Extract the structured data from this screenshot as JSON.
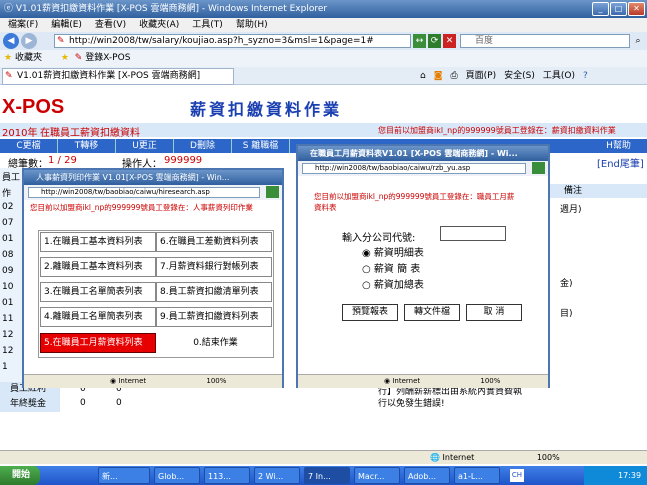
{
  "window": {
    "title": "V1.01薪資扣繳資料作業 [X-POS 雲端商務網] - Windows Internet Explorer",
    "address": "http://win2008/tw/salary/koujiao.asp?h_syzno=3&msl=1&page=1#",
    "search_placeholder": "百度",
    "menu": [
      "檔案(F)",
      "編輯(E)",
      "查看(V)",
      "收藏夾(A)",
      "工具(T)",
      "幫助(H)"
    ],
    "favorites_label": "收藏夾",
    "fav_link": "登錄X-POS",
    "tab_label": "V1.01薪資扣繳資料作業 [X-POS 雲端商務網]",
    "cmd": {
      "page": "頁面(P)",
      "safety": "安全(S)",
      "tools": "工具(O)"
    }
  },
  "page": {
    "logo": "X-POS",
    "title": "薪資扣繳資料作業",
    "year": "2010年",
    "subtitle": "在職員工薪資扣繳資料",
    "user_notice": "您目前以加盟商ikl_np的999999號員工登錄在：薪資扣繳資料作業",
    "toolbar": [
      "C更檔",
      "T轉移",
      "U更正",
      "D刪除",
      "S 離職檔"
    ],
    "help": "H幫助",
    "total_label": "總筆數：",
    "total_value": "1 / 29",
    "operator_label": "操作人：",
    "operator_value": "999999",
    "end_btn": "[End尾筆]",
    "col_remark": "備注",
    "remark_rows": [
      "週月)",
      "金)",
      "目)"
    ],
    "left_rows": [
      "員工",
      "作",
      "02",
      "07",
      "01",
      "08",
      "09",
      "10",
      "01",
      "11",
      "12",
      "12",
      "1",
      "員工紅利",
      "年終獎金"
    ],
    "bottom_rows": [
      {
        "label": "員工紅利",
        "v1": "0",
        "v2": "0"
      },
      {
        "label": "年終獎金",
        "v1": "0",
        "v2": "0"
      }
    ],
    "bottom_text1": "行】列酬薪薪標出由系統內實資費執",
    "bottom_text2": "行以免發生錯誤!"
  },
  "popup1": {
    "title": "人事薪資列印作業 V1.01[X-POS 雲端商務網] - Win...",
    "address": "http://win2008/tw/baobiao/caiwu/hiresearch.asp",
    "notice": "您目前以加盟商ikl_np的999999號員工登錄在：人事薪資列印作業",
    "buttons": [
      "1.在職員工基本資料列表",
      "6.在職員工差勤資料列表",
      "2.離職員工基本資料列表",
      "7.月薪資料銀行對帳列表",
      "3.在職員工名單簡表列表",
      "8.員工薪資扣繳清單列表",
      "4.離職員工名單簡表列表",
      "9.員工薪資扣繳資料列表",
      "5.在職員工月薪資料列表",
      "0.結束作業"
    ],
    "status": "Internet",
    "zoom": "100%"
  },
  "popup2": {
    "title": "在職員工月薪資料表V1.01 [X-POS 雲端商務網] - Wi...",
    "address": "http://win2008/tw/baobiao/caiwu/rzb_yu.asp",
    "notice1": "您目前以加盟商ikl_np的999999號員工登錄在：職員工月薪",
    "notice2": "資料表",
    "input_label": "輸入分公司代號:",
    "input_value": "",
    "options": [
      "薪資明細表",
      "薪資 簡 表",
      "薪資加總表"
    ],
    "btn_preview": "預覽報表",
    "btn_convert": "轉文件檔",
    "btn_cancel": "取 消",
    "status": "Internet",
    "zoom": "100%"
  },
  "main_status": {
    "zone": "Internet",
    "zoom": "100%"
  },
  "taskbar": {
    "start": "開始",
    "items": [
      "新...",
      "Glob...",
      "113...",
      "2 Wi...",
      "7 In...",
      "Macr...",
      "Adob...",
      "a1-L..."
    ],
    "lang": "CH",
    "clock": "17:39"
  }
}
